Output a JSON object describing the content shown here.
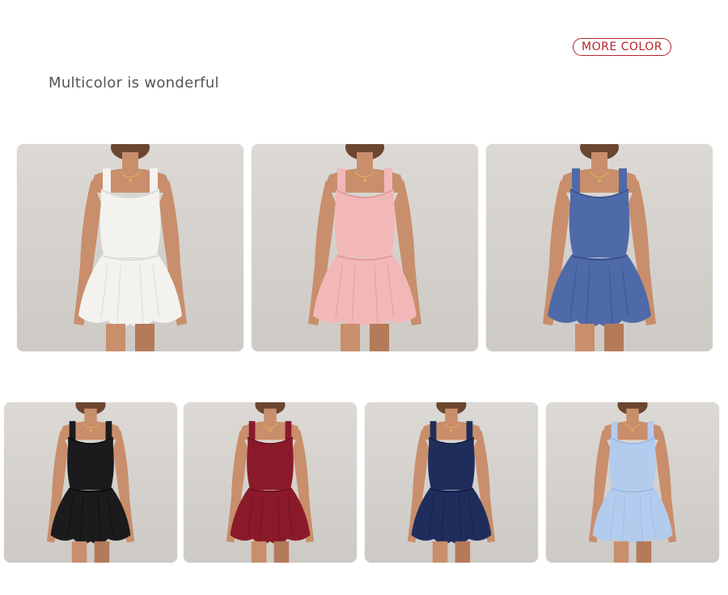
{
  "header": {
    "more_color_label": "MORE COLOR",
    "headline": "Multicolor is wonderful"
  },
  "accent_color": "#b3262d",
  "products": [
    {
      "color_name": "white",
      "hex": "#f3f2ef",
      "shade": "#dcdad6"
    },
    {
      "color_name": "pink",
      "hex": "#f2b8b8",
      "shade": "#e39c9d"
    },
    {
      "color_name": "blue",
      "hex": "#4f6aa8",
      "shade": "#3c5592"
    },
    {
      "color_name": "black",
      "hex": "#1b1b1d",
      "shade": "#0c0c0d"
    },
    {
      "color_name": "burgundy",
      "hex": "#8a1a2a",
      "shade": "#6f1120"
    },
    {
      "color_name": "navy",
      "hex": "#1f2d5c",
      "shade": "#141f45"
    },
    {
      "color_name": "light blue",
      "hex": "#b3ccee",
      "shade": "#97b6e3"
    }
  ]
}
